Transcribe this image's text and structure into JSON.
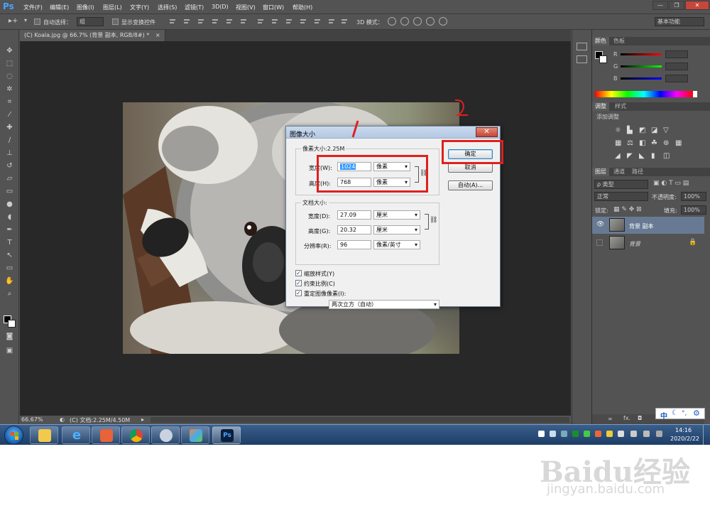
{
  "app": {
    "logo": "Ps",
    "menu": [
      "文件(F)",
      "编辑(E)",
      "图像(I)",
      "图层(L)",
      "文字(Y)",
      "选择(S)",
      "滤镜(T)",
      "3D(D)",
      "视图(V)",
      "窗口(W)",
      "帮助(H)"
    ],
    "window_buttons": [
      "—",
      "❐",
      "✕"
    ]
  },
  "options_bar": {
    "auto_select_label": "自动选择：",
    "auto_select_value": "组",
    "show_transform_label": "显示变换控件",
    "mode_3d_label": "3D 模式：",
    "workspace": "基本功能"
  },
  "document": {
    "tab_label": "(C) Koala.jpg @ 66.7% (背景 副本, RGB/8#) *",
    "tab_close": "×",
    "zoom": "66.67%",
    "doc_info": "(C) 文档:2.25M/4.50M"
  },
  "panels": {
    "color_tabs": [
      "颜色",
      "色板"
    ],
    "channels": [
      "R",
      "G",
      "B"
    ],
    "adjust_tabs": [
      "调整",
      "样式"
    ],
    "adjust_hint": "添加调整",
    "layer_tabs": [
      "图层",
      "通道",
      "路径"
    ],
    "layer_filter": "ρ 类型",
    "blend_mode": "正常",
    "opacity_label": "不透明度:",
    "opacity_value": "100%",
    "lock_label": "锁定:",
    "fill_label": "填充:",
    "fill_value": "100%",
    "layers": [
      {
        "name": "背景 副本"
      },
      {
        "name": "背景"
      }
    ],
    "ime": "中",
    "bottom_icons": "fx."
  },
  "dialog": {
    "title": "图像大小",
    "close": "✕",
    "pixel_dim_label": "像素大小:2.25M",
    "width_label": "宽度(W):",
    "width_value": "1024",
    "width_unit": "像素",
    "height_label": "高度(H):",
    "height_value": "768",
    "height_unit": "像素",
    "doc_size_label": "文档大小:",
    "doc_width_label": "宽度(D):",
    "doc_width_value": "27.09",
    "doc_width_unit": "厘米",
    "doc_height_label": "高度(G):",
    "doc_height_value": "20.32",
    "doc_height_unit": "厘米",
    "resolution_label": "分辨率(R):",
    "resolution_value": "96",
    "resolution_unit": "像素/英寸",
    "scale_styles": "缩放样式(Y)",
    "constrain": "约束比例(C)",
    "resample": "重定图像像素(I):",
    "resample_method": "两次立方（自动）",
    "ok": "确定",
    "cancel": "取消",
    "auto": "自动(A)...",
    "annotation_2": "2"
  },
  "taskbar": {
    "time": "14:16",
    "date": "2020/2/22"
  },
  "watermark": {
    "text": "Baidu经验",
    "url": "jingyan.baidu.com"
  }
}
